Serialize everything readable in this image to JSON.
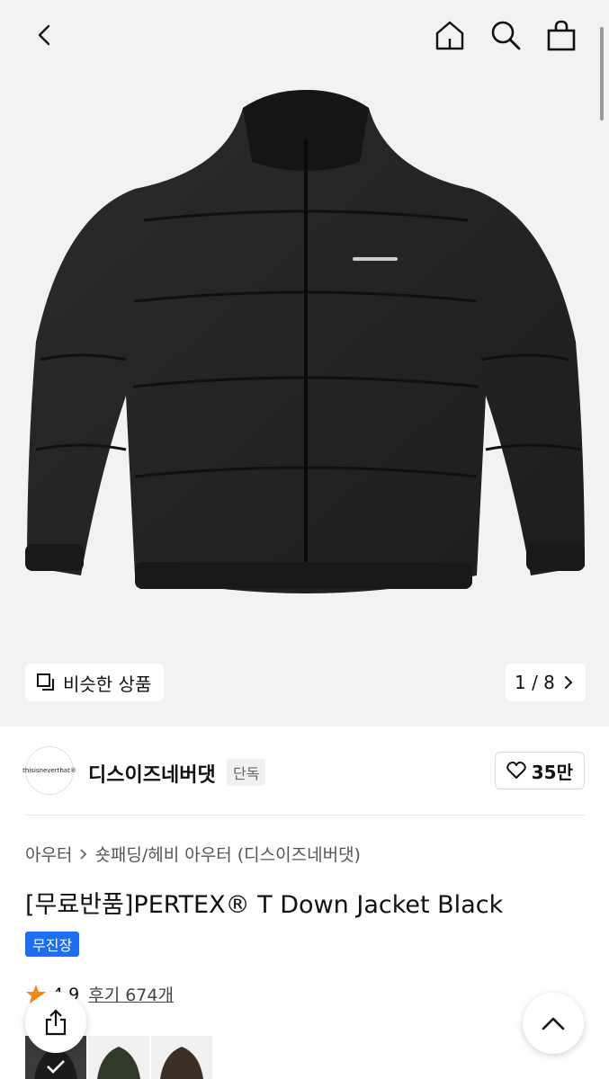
{
  "header": {
    "back_icon": "chevron-left-icon",
    "home_icon": "home-icon",
    "search_icon": "search-icon",
    "cart_icon": "shopping-bag-icon"
  },
  "hero": {
    "similar_label": "비슷한 상품",
    "pager": "1 / 8"
  },
  "brand": {
    "logo_text": "thisisneverthat®",
    "name": "디스이즈네버댓",
    "tag": "단독",
    "likes": "35만"
  },
  "breadcrumb": {
    "items": [
      "아우터",
      "숏패딩/헤비 아우터 (디스이즈네버댓)"
    ]
  },
  "product": {
    "title": "[무료반품]PERTEX® T Down Jacket Black",
    "badge": "무진장",
    "rating": "4.9",
    "reviews": "후기 674개"
  },
  "colors": {
    "accent_blue": "#1f6df0",
    "star": "#f28a1a",
    "hero_bg": "#f2f2f3"
  }
}
